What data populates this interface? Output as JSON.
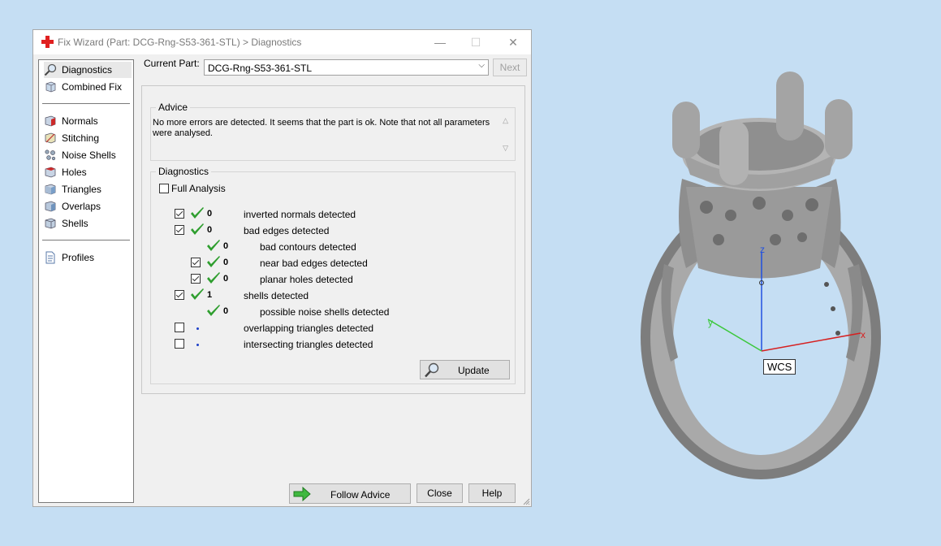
{
  "window": {
    "title": "Fix Wizard (Part: DCG-Rng-S53-361-STL) > Diagnostics",
    "minimize": "—",
    "maximize": "☐",
    "close": "✕"
  },
  "sidebar": {
    "items": [
      {
        "label": "Diagnostics",
        "icon": "magnifier-icon"
      },
      {
        "label": "Combined Fix",
        "icon": "cube-icon"
      },
      {
        "label": "Normals",
        "icon": "normals-icon"
      },
      {
        "label": "Stitching",
        "icon": "stitching-icon"
      },
      {
        "label": "Noise Shells",
        "icon": "noise-shells-icon"
      },
      {
        "label": "Holes",
        "icon": "holes-icon"
      },
      {
        "label": "Triangles",
        "icon": "triangles-icon"
      },
      {
        "label": "Overlaps",
        "icon": "overlaps-icon"
      },
      {
        "label": "Shells",
        "icon": "shells-icon"
      },
      {
        "label": "Profiles",
        "icon": "document-icon"
      }
    ]
  },
  "header": {
    "current_part_label": "Current Part:",
    "current_part_value": "DCG-Rng-S53-361-STL",
    "next_label": "Next"
  },
  "advice": {
    "title": "Advice",
    "text": "No more errors are detected. It seems that the part is ok. Note that not all parameters were analysed."
  },
  "diagnostics": {
    "title": "Diagnostics",
    "full_analysis_label": "Full Analysis",
    "full_analysis_checked": false,
    "rows": [
      {
        "checkbox": "checked",
        "status": "ok",
        "count": "0",
        "label": "inverted normals detected",
        "indent": 0
      },
      {
        "checkbox": "checked",
        "status": "ok",
        "count": "0",
        "label": "bad edges detected",
        "indent": 0
      },
      {
        "checkbox": "none",
        "status": "ok",
        "count": "0",
        "label": "bad contours detected",
        "indent": 1
      },
      {
        "checkbox": "checked",
        "status": "ok",
        "count": "0",
        "label": "near bad edges detected",
        "indent": 1
      },
      {
        "checkbox": "checked",
        "status": "ok",
        "count": "0",
        "label": "planar holes detected",
        "indent": 1
      },
      {
        "checkbox": "checked",
        "status": "ok",
        "count": "1",
        "label": "shells detected",
        "indent": 0
      },
      {
        "checkbox": "none",
        "status": "ok",
        "count": "0",
        "label": "possible noise shells detected",
        "indent": 1
      },
      {
        "checkbox": "unchecked",
        "status": "dot",
        "count": "",
        "label": "overlapping triangles detected",
        "indent": 0
      },
      {
        "checkbox": "unchecked",
        "status": "dot",
        "count": "",
        "label": "intersecting triangles detected",
        "indent": 0
      }
    ],
    "update_label": "Update"
  },
  "footer": {
    "follow_advice_label": "Follow Advice",
    "close_label": "Close",
    "help_label": "Help"
  },
  "viewport": {
    "wcs_label": "WCS",
    "axis_x": "x",
    "axis_y": "y",
    "axis_z": "z"
  },
  "colors": {
    "check_green": "#2e9e2e",
    "axis_x": "#d62020",
    "axis_y": "#3cc83c",
    "axis_z": "#2050e0",
    "background": "#c5def3"
  }
}
